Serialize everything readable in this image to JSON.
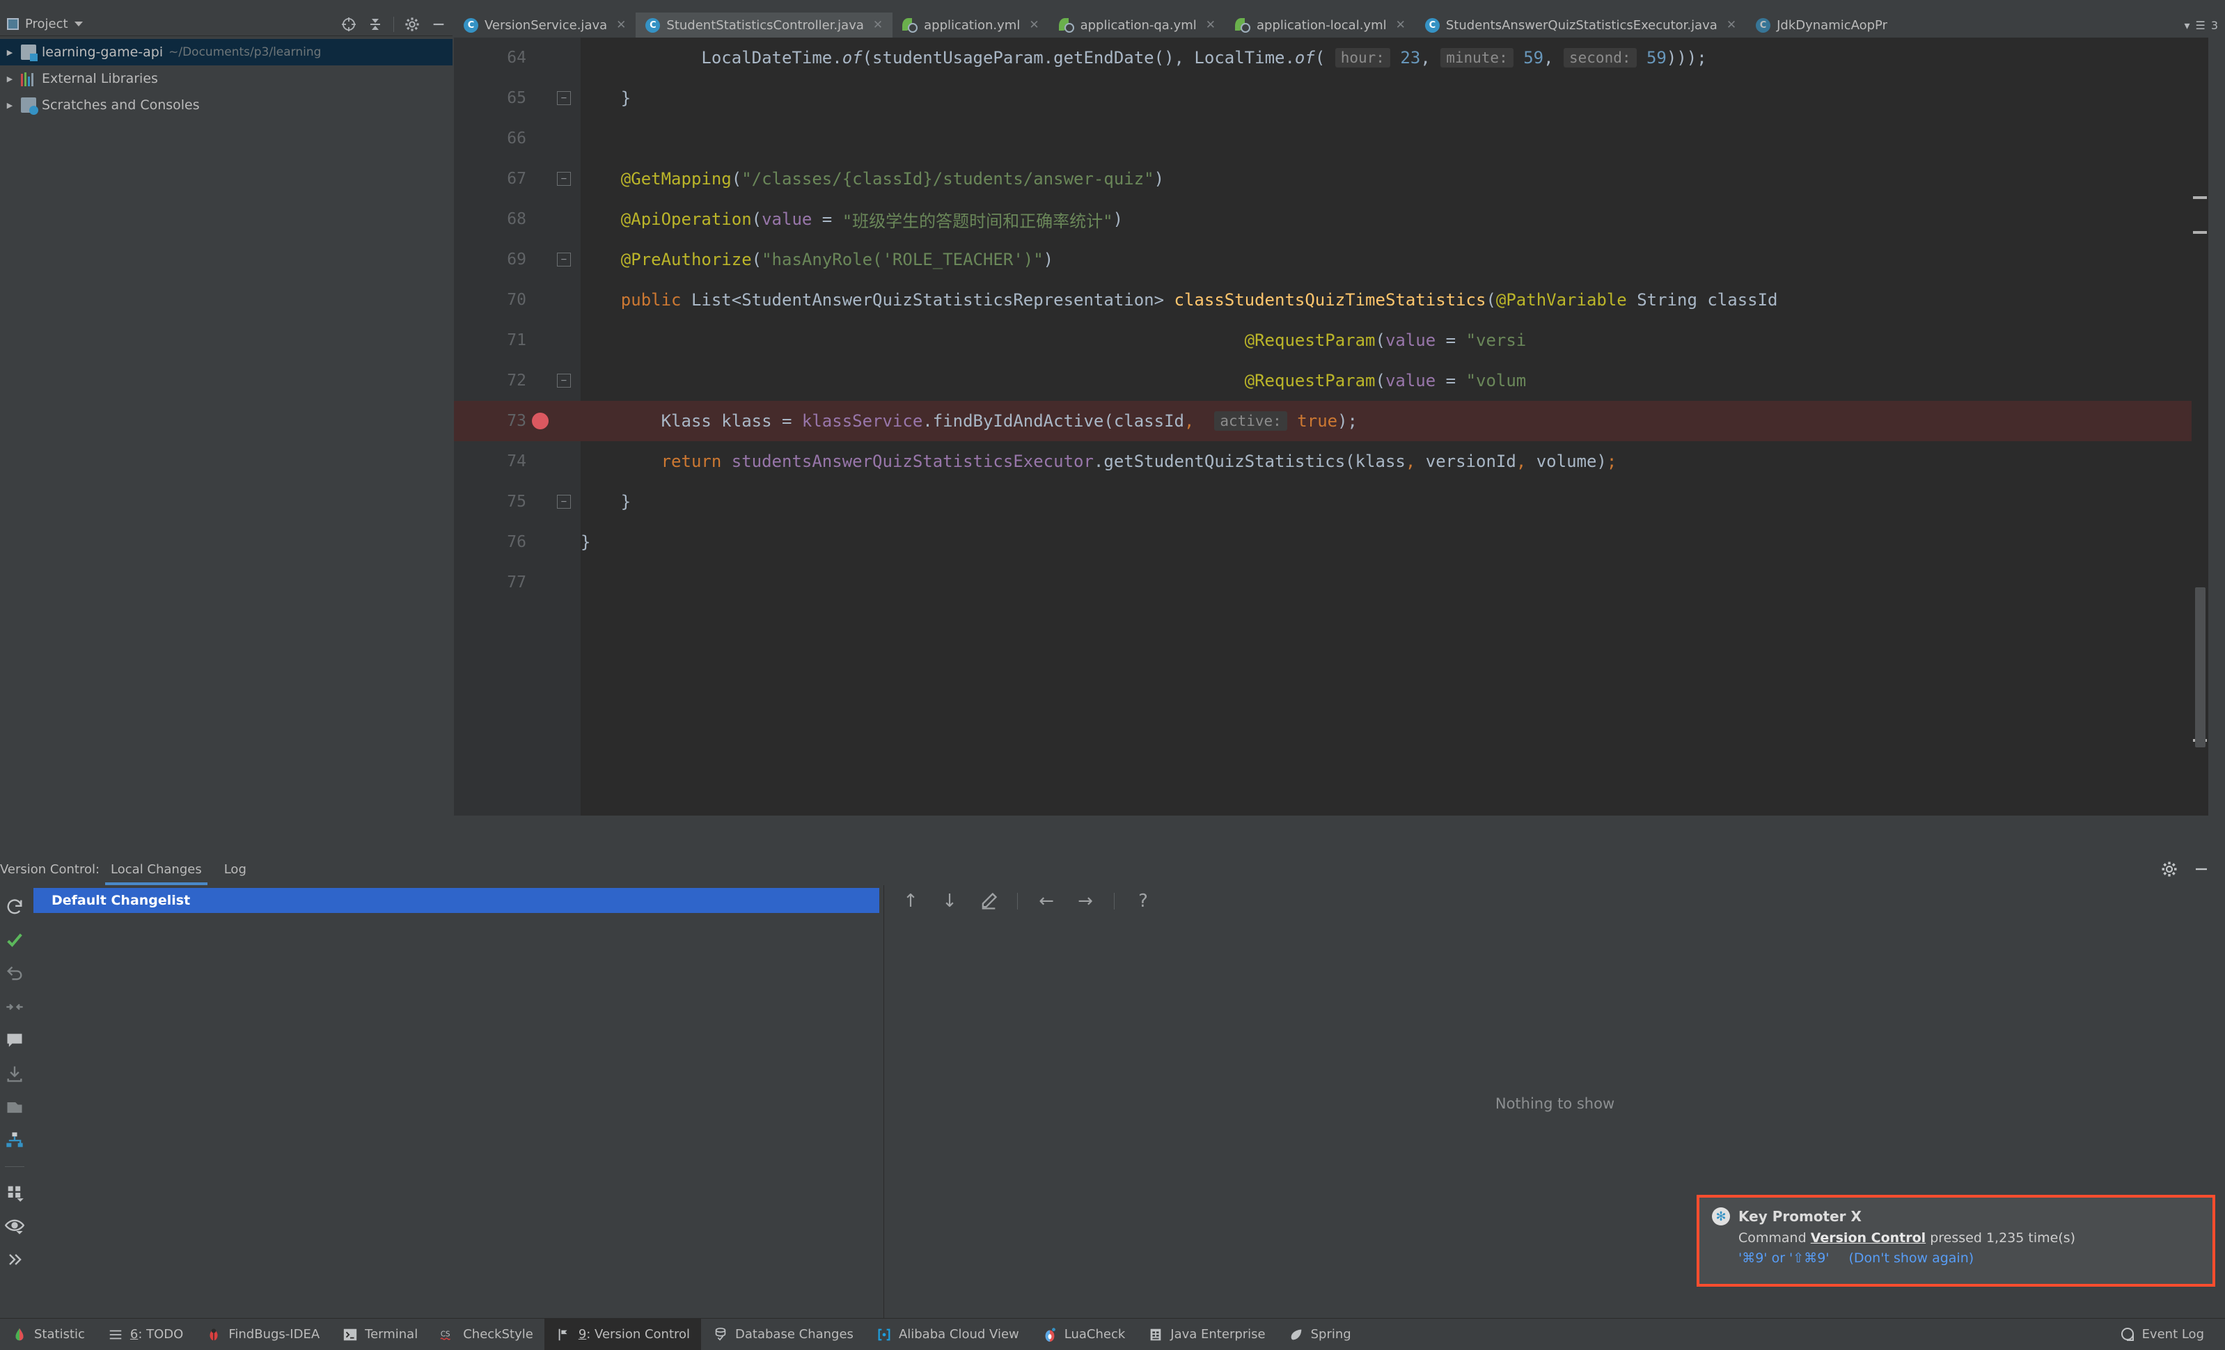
{
  "project": {
    "panel_title": "Project",
    "tree": [
      {
        "label": "learning-game-api",
        "path": "~/Documents/p3/learning",
        "icon": "module-icon",
        "selected": true
      },
      {
        "label": "External Libraries",
        "path": "",
        "icon": "libraries-icon",
        "selected": false
      },
      {
        "label": "Scratches and Consoles",
        "path": "",
        "icon": "scratches-icon",
        "selected": false
      }
    ]
  },
  "tabs": [
    {
      "label": "VersionService.java",
      "icon": "java-class-icon",
      "active": false
    },
    {
      "label": "StudentStatisticsController.java",
      "icon": "java-class-icon",
      "active": true
    },
    {
      "label": "application.yml",
      "icon": "spring-yaml-icon",
      "active": false
    },
    {
      "label": "application-qa.yml",
      "icon": "spring-yaml-icon",
      "active": false
    },
    {
      "label": "application-local.yml",
      "icon": "spring-yaml-icon",
      "active": false
    },
    {
      "label": "StudentsAnswerQuizStatisticsExecutor.java",
      "icon": "java-class-icon",
      "active": false
    },
    {
      "label": "JdkDynamicAopPr",
      "icon": "java-class-icon",
      "active": false
    }
  ],
  "tabs_overflow_count": "3",
  "editor": {
    "lines": [
      {
        "num": "64",
        "indent": 13,
        "breakpoint": false,
        "fold": false,
        "error": false,
        "tokens": [
          {
            "t": "            ",
            "c": "t-def"
          },
          {
            "t": "LocalDateTime.",
            "c": "t-def"
          },
          {
            "t": "of",
            "c": "t-def t-italic"
          },
          {
            "t": "(studentUsageParam.getEndDate(), LocalTime.",
            "c": "t-def"
          },
          {
            "t": "of",
            "c": "t-def t-italic"
          },
          {
            "t": "( ",
            "c": "t-def"
          },
          {
            "t": "hour:",
            "c": "hintbox"
          },
          {
            "t": " ",
            "c": "t-def"
          },
          {
            "t": "23",
            "c": "t-num"
          },
          {
            "t": ", ",
            "c": "t-def"
          },
          {
            "t": "minute:",
            "c": "hintbox"
          },
          {
            "t": " ",
            "c": "t-def"
          },
          {
            "t": "59",
            "c": "t-num"
          },
          {
            "t": ", ",
            "c": "t-def"
          },
          {
            "t": "second:",
            "c": "hintbox"
          },
          {
            "t": " ",
            "c": "t-def"
          },
          {
            "t": "59",
            "c": "t-num"
          },
          {
            "t": ")));",
            "c": "t-def"
          }
        ]
      },
      {
        "num": "65",
        "breakpoint": false,
        "fold": true,
        "error": false,
        "tokens": [
          {
            "t": "    }",
            "c": "t-def"
          }
        ]
      },
      {
        "num": "66",
        "breakpoint": false,
        "fold": false,
        "error": false,
        "tokens": []
      },
      {
        "num": "67",
        "breakpoint": false,
        "fold": true,
        "error": false,
        "tokens": [
          {
            "t": "    ",
            "c": "t-def"
          },
          {
            "t": "@GetMapping",
            "c": "t-anno"
          },
          {
            "t": "(",
            "c": "t-def"
          },
          {
            "t": "\"/classes/{classId}/students/answer-quiz\"",
            "c": "t-str"
          },
          {
            "t": ")",
            "c": "t-def"
          }
        ]
      },
      {
        "num": "68",
        "breakpoint": false,
        "fold": false,
        "error": false,
        "tokens": [
          {
            "t": "    ",
            "c": "t-def"
          },
          {
            "t": "@ApiOperation",
            "c": "t-anno"
          },
          {
            "t": "(",
            "c": "t-def"
          },
          {
            "t": "value",
            "c": "t-field"
          },
          {
            "t": " = ",
            "c": "t-def"
          },
          {
            "t": "\"班级学生的答题时间和正确率统计\"",
            "c": "t-str"
          },
          {
            "t": ")",
            "c": "t-def"
          }
        ]
      },
      {
        "num": "69",
        "breakpoint": false,
        "fold": true,
        "error": false,
        "tokens": [
          {
            "t": "    ",
            "c": "t-def"
          },
          {
            "t": "@PreAuthorize",
            "c": "t-anno"
          },
          {
            "t": "(",
            "c": "t-def"
          },
          {
            "t": "\"hasAnyRole('ROLE_TEACHER')\"",
            "c": "t-str"
          },
          {
            "t": ")",
            "c": "t-def"
          }
        ]
      },
      {
        "num": "70",
        "breakpoint": false,
        "fold": false,
        "error": false,
        "tokens": [
          {
            "t": "    ",
            "c": "t-def"
          },
          {
            "t": "public",
            "c": "t-kw"
          },
          {
            "t": " List<StudentAnswerQuizStatisticsRepresentation> ",
            "c": "t-def"
          },
          {
            "t": "classStudentsQuizTimeStatistics",
            "c": "t-method"
          },
          {
            "t": "(",
            "c": "t-def"
          },
          {
            "t": "@PathVariable",
            "c": "t-anno"
          },
          {
            "t": " String classId",
            "c": "t-def"
          }
        ]
      },
      {
        "num": "71",
        "breakpoint": false,
        "fold": false,
        "error": false,
        "tokens": [
          {
            "t": "                                                                  ",
            "c": "t-def"
          },
          {
            "t": "@RequestParam",
            "c": "t-anno"
          },
          {
            "t": "(",
            "c": "t-def"
          },
          {
            "t": "value",
            "c": "t-field"
          },
          {
            "t": " = ",
            "c": "t-def"
          },
          {
            "t": "\"versi",
            "c": "t-str"
          }
        ]
      },
      {
        "num": "72",
        "breakpoint": false,
        "fold": true,
        "error": false,
        "tokens": [
          {
            "t": "                                                                  ",
            "c": "t-def"
          },
          {
            "t": "@RequestParam",
            "c": "t-anno"
          },
          {
            "t": "(",
            "c": "t-def"
          },
          {
            "t": "value",
            "c": "t-field"
          },
          {
            "t": " = ",
            "c": "t-def"
          },
          {
            "t": "\"volum",
            "c": "t-str"
          }
        ]
      },
      {
        "num": "73",
        "breakpoint": true,
        "fold": false,
        "error": true,
        "tokens": [
          {
            "t": "        Klass klass = ",
            "c": "t-def"
          },
          {
            "t": "klassService",
            "c": "t-field"
          },
          {
            "t": ".findByIdAndActive(classId",
            "c": "t-def"
          },
          {
            "t": ",",
            "c": "t-kw"
          },
          {
            "t": "  ",
            "c": "t-def"
          },
          {
            "t": "active:",
            "c": "hintbox"
          },
          {
            "t": " ",
            "c": "t-def"
          },
          {
            "t": "true",
            "c": "t-kw"
          },
          {
            "t": ");",
            "c": "t-def"
          }
        ]
      },
      {
        "num": "74",
        "breakpoint": false,
        "fold": false,
        "error": false,
        "tokens": [
          {
            "t": "        ",
            "c": "t-def"
          },
          {
            "t": "return",
            "c": "t-kw"
          },
          {
            "t": " ",
            "c": "t-def"
          },
          {
            "t": "studentsAnswerQuizStatisticsExecutor",
            "c": "t-field"
          },
          {
            "t": ".getStudentQuizStatistics(klass",
            "c": "t-def"
          },
          {
            "t": ",",
            "c": "t-kw"
          },
          {
            "t": " versionId",
            "c": "t-def"
          },
          {
            "t": ",",
            "c": "t-kw"
          },
          {
            "t": " volume)",
            "c": "t-def"
          },
          {
            "t": ";",
            "c": "t-kw"
          }
        ]
      },
      {
        "num": "75",
        "breakpoint": false,
        "fold": true,
        "error": false,
        "tokens": [
          {
            "t": "    }",
            "c": "t-def"
          }
        ]
      },
      {
        "num": "76",
        "breakpoint": false,
        "fold": false,
        "error": false,
        "tokens": [
          {
            "t": "}",
            "c": "t-def"
          }
        ]
      },
      {
        "num": "77",
        "breakpoint": false,
        "fold": false,
        "error": false,
        "tokens": []
      }
    ]
  },
  "version_control": {
    "panel_label": "Version Control:",
    "tabs": [
      {
        "label": "Local Changes",
        "active": true
      },
      {
        "label": "Log",
        "active": false
      }
    ],
    "changelist": "Default Changelist",
    "empty_message": "Nothing to show",
    "toolbar_icons": [
      "arrow-up-icon",
      "arrow-down-icon",
      "edit-icon",
      "arrow-left-icon",
      "arrow-right-icon",
      "help-icon"
    ],
    "rail_icons": [
      "refresh-icon",
      "commit-check-icon",
      "rollback-icon",
      "shelve-icon",
      "comment-icon",
      "get-icon",
      "shelf-icon",
      "group-by-icon",
      "view-options-icon",
      "preview-eye-icon",
      "expand-icon"
    ]
  },
  "notification": {
    "title": "Key Promoter X",
    "message_prefix": "Command ",
    "message_bold": "Version Control",
    "message_suffix": " pressed 1,235 time(s)",
    "shortcut": "'⌘9' or '⇧⌘9'",
    "dismiss": "(Don't show again)",
    "border_color": "#ff4d2e"
  },
  "statusbar": {
    "left_items": [
      {
        "label": "Statistic",
        "icon": "statistic-icon",
        "active": false,
        "mnemonic": ""
      },
      {
        "label": ": TODO",
        "icon": "todo-icon",
        "active": false,
        "mnemonic": "6"
      },
      {
        "label": "FindBugs-IDEA",
        "icon": "findbugs-icon",
        "active": false,
        "mnemonic": ""
      },
      {
        "label": "Terminal",
        "icon": "terminal-icon",
        "active": false,
        "mnemonic": ""
      },
      {
        "label": "CheckStyle",
        "icon": "checkstyle-icon",
        "active": false,
        "mnemonic": ""
      },
      {
        "label": ": Version Control",
        "icon": "version-control-icon",
        "active": true,
        "mnemonic": "9"
      },
      {
        "label": "Database Changes",
        "icon": "database-icon",
        "active": false,
        "mnemonic": ""
      },
      {
        "label": "Alibaba Cloud View",
        "icon": "alibaba-cloud-icon",
        "active": false,
        "mnemonic": ""
      },
      {
        "label": "LuaCheck",
        "icon": "luacheck-icon",
        "active": false,
        "mnemonic": ""
      },
      {
        "label": "Java Enterprise",
        "icon": "java-enterprise-icon",
        "active": false,
        "mnemonic": ""
      },
      {
        "label": "Spring",
        "icon": "spring-icon",
        "active": false,
        "mnemonic": ""
      }
    ],
    "right_item": {
      "label": "Event Log",
      "icon": "event-log-icon"
    }
  }
}
